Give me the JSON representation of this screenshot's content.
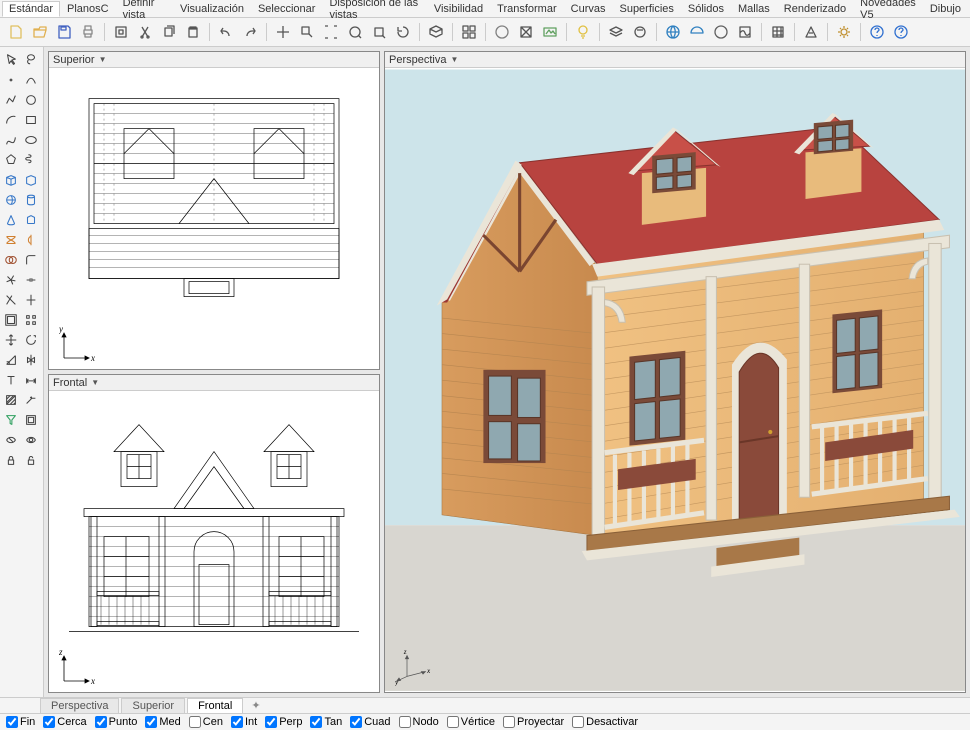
{
  "menu_tabs": [
    "Estándar",
    "PlanosC",
    "Definir vista",
    "Visualización",
    "Seleccionar",
    "Disposición de las vistas",
    "Visibilidad",
    "Transformar",
    "Curvas",
    "Superficies",
    "Sólidos",
    "Mallas",
    "Renderizado",
    "Novedades V5",
    "Dibujo"
  ],
  "menu_active": 0,
  "toolbar_icons": [
    "new",
    "open",
    "save",
    "print",
    "sep",
    "export",
    "cut",
    "copy",
    "paste",
    "sep",
    "undo",
    "redo",
    "sep",
    "pan",
    "zoom-window",
    "zoom-extents",
    "zoom-dynamic",
    "zoom-selected",
    "rotate",
    "sep",
    "named-view",
    "sep",
    "4view",
    "sep",
    "shade",
    "wireframe",
    "render-preview",
    "sep",
    "light",
    "sep",
    "layer",
    "material",
    "sep",
    "world",
    "hemisphere",
    "fullsphere",
    "env",
    "sep",
    "texture",
    "sep",
    "osnap",
    "sep",
    "options",
    "sep",
    "why",
    "help"
  ],
  "left_tools": [
    [
      "pointer",
      "lasso"
    ],
    [
      "point",
      "curve-interp"
    ],
    [
      "polyline",
      "circle"
    ],
    [
      "arc",
      "rectangle"
    ],
    [
      "spline",
      "ellipse"
    ],
    [
      "polygon",
      "helix"
    ],
    [
      "box",
      "box-pts"
    ],
    [
      "sphere",
      "cylinder"
    ],
    [
      "cone",
      "extrude-crv"
    ],
    [
      "loft",
      "revolve"
    ],
    [
      "boolean",
      "fillet-srf"
    ],
    [
      "explode",
      "join"
    ],
    [
      "trim",
      "split"
    ],
    [
      "offset",
      "array"
    ],
    [
      "move",
      "rotate-obj"
    ],
    [
      "scale",
      "mirror"
    ],
    [
      "text",
      "dim"
    ],
    [
      "hatch",
      "leader"
    ],
    [
      "sel-filter",
      "sel-all"
    ],
    [
      "hide",
      "show"
    ],
    [
      "lock",
      "unlock"
    ]
  ],
  "viewports": {
    "top": {
      "title": "Superior",
      "axes": [
        "x",
        "y"
      ]
    },
    "front": {
      "title": "Frontal",
      "axes": [
        "x",
        "z"
      ]
    },
    "perspective": {
      "title": "Perspectiva",
      "axes": [
        "x",
        "y",
        "z"
      ]
    }
  },
  "bottom_tabs": [
    "Perspectiva",
    "Superior",
    "Frontal"
  ],
  "bottom_active": 2,
  "snaps": [
    {
      "label": "Fin",
      "checked": true
    },
    {
      "label": "Cerca",
      "checked": true
    },
    {
      "label": "Punto",
      "checked": true
    },
    {
      "label": "Med",
      "checked": true
    },
    {
      "label": "Cen",
      "checked": false
    },
    {
      "label": "Int",
      "checked": true
    },
    {
      "label": "Perp",
      "checked": true
    },
    {
      "label": "Tan",
      "checked": true
    },
    {
      "label": "Cuad",
      "checked": true
    },
    {
      "label": "Nodo",
      "checked": false
    },
    {
      "label": "Vértice",
      "checked": false
    },
    {
      "label": "Proyectar",
      "checked": false
    },
    {
      "label": "Desactivar",
      "checked": false
    }
  ],
  "colors": {
    "roof": "#b8433f",
    "wall": "#e6b373",
    "trim": "#eae5d8",
    "door": "#8a4a3a",
    "sky": "#cde4ea",
    "ground": "#d8d6d0"
  }
}
